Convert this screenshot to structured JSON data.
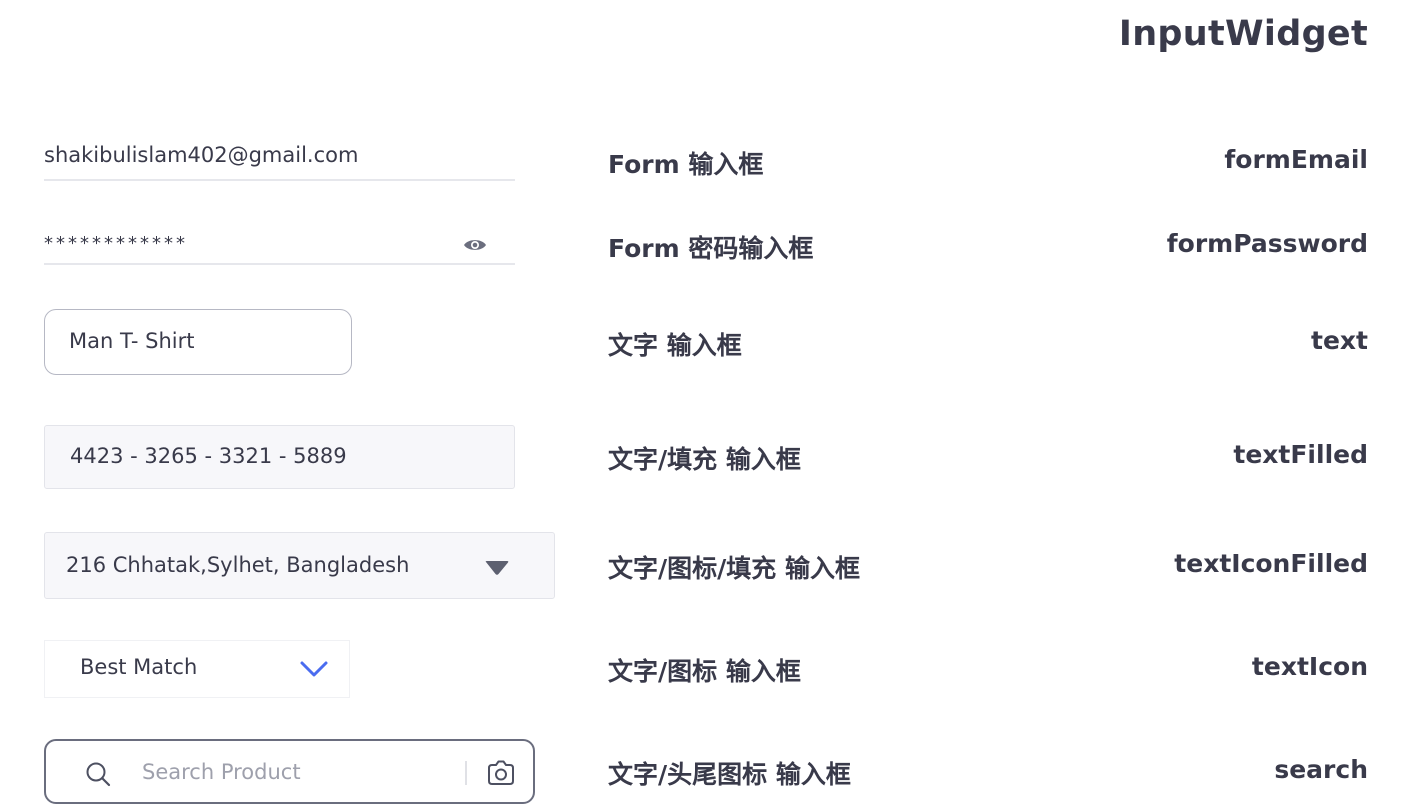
{
  "page": {
    "title": "InputWidget"
  },
  "rows": [
    {
      "label_cn": "Form 输入框",
      "name": "formEmail",
      "value": "shakibulislam402@gmail.com"
    },
    {
      "label_cn": "Form 密码输入框",
      "name": "formPassword",
      "value": "************"
    },
    {
      "label_cn": "文字 输入框",
      "name": "text",
      "value": "Man T- Shirt"
    },
    {
      "label_cn": "文字/填充 输入框",
      "name": "textFilled",
      "value": "4423 - 3265 - 3321 - 5889"
    },
    {
      "label_cn": "文字/图标/填充 输入框",
      "name": "textIconFilled",
      "value": "216 Chhatak,Sylhet, Bangladesh"
    },
    {
      "label_cn": "文字/图标 输入框",
      "name": "textIcon",
      "value": "Best Match"
    },
    {
      "label_cn": "文字/头尾图标 输入框",
      "name": "search",
      "placeholder": "Search Product"
    }
  ],
  "icons": {
    "password_toggle": "eye-icon",
    "address_dropdown": "caret-down-filled-icon",
    "sort_dropdown": "chevron-down-icon",
    "search_leading": "search-icon",
    "search_trailing": "camera-icon"
  },
  "colors": {
    "text": "#393a4a",
    "placeholder": "#9ea0ac",
    "accent": "#4a6cf0",
    "fill": "#f7f7fa",
    "border": "#b6b8c4"
  }
}
